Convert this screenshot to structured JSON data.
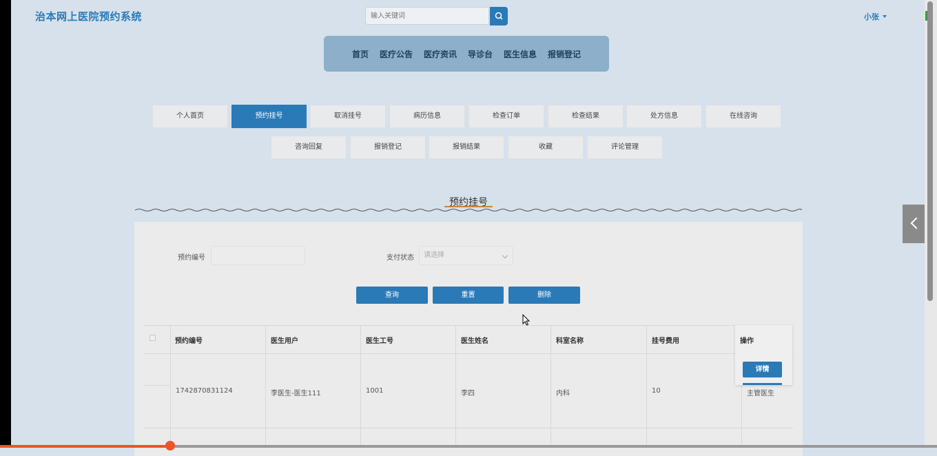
{
  "header": {
    "site_title": "治本网上医院预约系统",
    "search_placeholder": "输入关键词",
    "user_name": "小张"
  },
  "main_nav": [
    "首页",
    "医疗公告",
    "医疗资讯",
    "导诊台",
    "医生信息",
    "报销登记"
  ],
  "tabs_row1": [
    "个人首页",
    "预约挂号",
    "取消挂号",
    "病历信息",
    "检查订单",
    "检查结果",
    "处方信息",
    "在线咨询"
  ],
  "tabs_row2": [
    "咨询回复",
    "报销登记",
    "报销结果",
    "收藏",
    "评论管理"
  ],
  "active_tab": "预约挂号",
  "section_title": "预约挂号",
  "filters": {
    "appointment_no_label": "预约编号",
    "appointment_no_value": "",
    "pay_status_label": "支付状态",
    "pay_status_placeholder": "请选择"
  },
  "actions": {
    "query": "查询",
    "reset": "重置",
    "delete": "删除"
  },
  "table": {
    "headers": [
      "预约编号",
      "医生用户",
      "医生工号",
      "医生姓名",
      "科室名称",
      "挂号费用",
      "操作"
    ],
    "rows": [
      {
        "appointment_no": "1742870831124",
        "doctor_user": "李医生-医生111",
        "doctor_id": "1001",
        "doctor_name": "李四",
        "department": "内科",
        "fee": "10",
        "extra": "主管医生"
      }
    ],
    "detail_button": "详情"
  },
  "colors": {
    "accent": "#2a7ab8",
    "background": "#d6e1ec",
    "nav": "#8dafc9",
    "progress": "#e8562a"
  },
  "icons": [
    "search-icon",
    "chevron-down-icon",
    "chevron-left-icon"
  ]
}
